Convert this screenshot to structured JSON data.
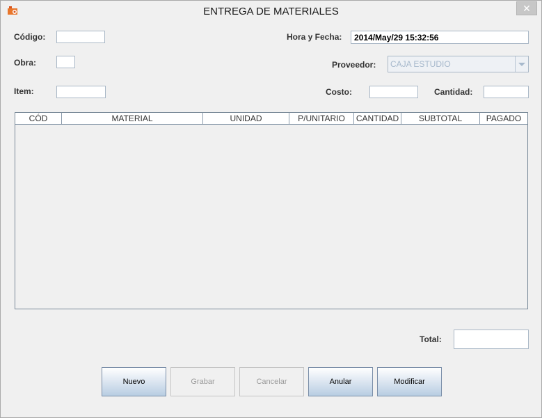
{
  "window": {
    "title": "ENTREGA DE MATERIALES",
    "close_glyph": "✕"
  },
  "form": {
    "codigo_label": "Código:",
    "codigo_value": "",
    "obra_label": "Obra:",
    "obra_value": "",
    "item_label": "Item:",
    "item_value": "",
    "hora_fecha_label": "Hora y Fecha:",
    "hora_fecha_value": "2014/May/29 15:32:56",
    "proveedor_label": "Proveedor:",
    "proveedor_value": "CAJA ESTUDIO",
    "costo_label": "Costo:",
    "costo_value": "",
    "cantidad_label": "Cantidad:",
    "cantidad_value": ""
  },
  "table": {
    "columns": [
      "CÓD",
      "MATERIAL",
      "UNIDAD",
      "P/UNITARIO",
      "CANTIDAD",
      "SUBTOTAL",
      "PAGADO"
    ],
    "rows": []
  },
  "totals": {
    "total_label": "Total:",
    "total_value": ""
  },
  "buttons": {
    "nuevo": "Nuevo",
    "grabar": "Grabar",
    "cancelar": "Cancelar",
    "anular": "Anular",
    "modificar": "Modificar"
  },
  "colors": {
    "accent": "#dfe8f2",
    "disabled_text": "#9a9a9a",
    "field_border": "#a9b7c6"
  }
}
